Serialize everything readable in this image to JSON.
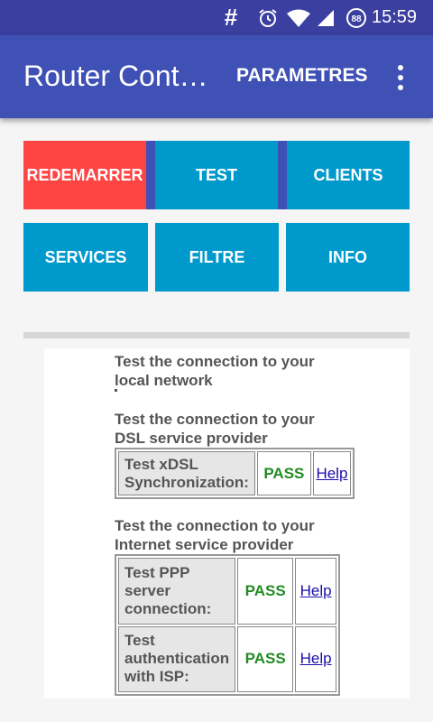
{
  "status_bar": {
    "hash_glyph": "#",
    "alarm_icon": "alarm-icon",
    "wifi_icon": "wifi-icon",
    "signal_icon": "signal-icon",
    "battery_level": "88",
    "time": "15:59"
  },
  "app_bar": {
    "title": "Router Control",
    "action_label": "PARAMETRES",
    "overflow_icon": "more-vert-icon",
    "color": "#3f51b5"
  },
  "buttons": {
    "restart": "REDEMARRER",
    "test": "TEST",
    "clients": "CLIENTS",
    "services": "SERVICES",
    "filter": "FILTRE",
    "info": "INFO",
    "primary_color": "#0099cc",
    "active_color": "#ff4444"
  },
  "report": {
    "local_heading": "Test the connection to your local network",
    "dsl_heading": "Test the connection to your DSL service provider",
    "dsl_test": {
      "label": "Test xDSL Synchronization:",
      "result": "PASS",
      "help": "Help"
    },
    "isp_heading": "Test the connection to your Internet service provider",
    "ppp_test": {
      "label": "Test PPP server connection:",
      "result": "PASS",
      "help": "Help"
    },
    "auth_test": {
      "label": "Test authentication with ISP:",
      "result": "PASS",
      "help": "Help"
    },
    "pass_color": "#228b22"
  }
}
